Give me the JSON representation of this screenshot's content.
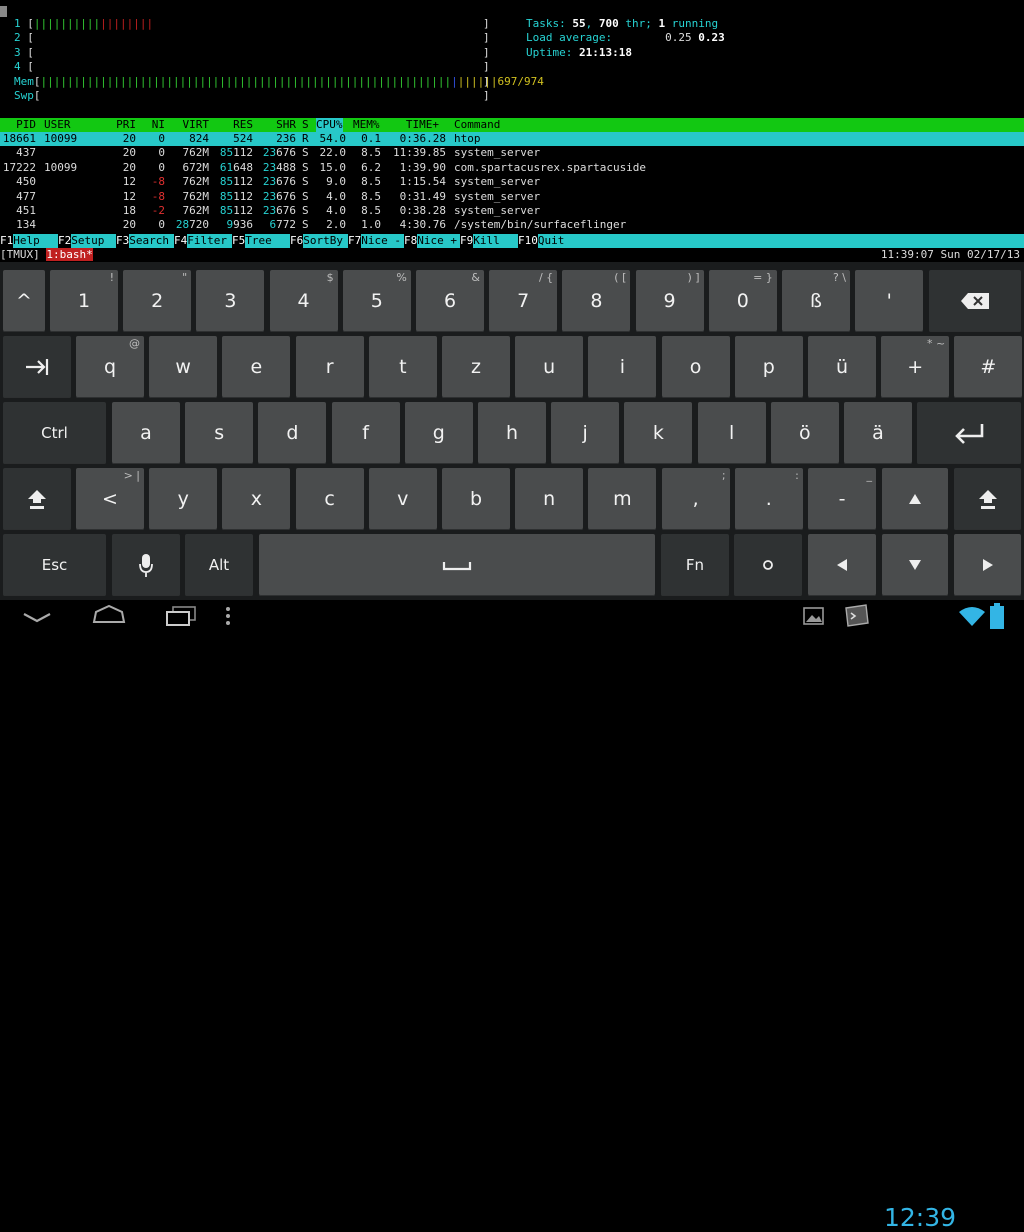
{
  "meters": {
    "cpu": [
      {
        "label": "1",
        "green": "||||||||||",
        "red": "||||||||"
      },
      {
        "label": "2",
        "green": "",
        "red": ""
      },
      {
        "label": "3",
        "green": "",
        "red": ""
      },
      {
        "label": "4",
        "green": "",
        "red": ""
      }
    ],
    "mem": {
      "label": "Mem",
      "bar": "||||||||||||||||||||||||||||||||||||||||||||||||||||||||||||||",
      "tail": "||||||",
      "value": "697/974"
    },
    "swp": {
      "label": "Swp"
    }
  },
  "stats": {
    "tasks_label": "Tasks: ",
    "tasks": "55",
    "thr_sep": ", ",
    "thr": "700",
    "thr_label": " thr; ",
    "running": "1",
    "running_label": " running",
    "load_label": "Load average:",
    "load1": "0.25",
    "load5": "0.23",
    "uptime_label": "Uptime: ",
    "uptime": "21:13:18"
  },
  "columns": [
    "PID",
    "USER",
    "PRI",
    "NI",
    "VIRT",
    "RES",
    "SHR",
    "S",
    "CPU%",
    "MEM%",
    "TIME+",
    "Command"
  ],
  "processes": [
    {
      "pid": "18661",
      "user": "10099",
      "pri": "20",
      "ni": "0",
      "virt": "824",
      "res": "524",
      "shr": "236",
      "s": "R",
      "cpu": "54.0",
      "mem": "0.1",
      "time": "0:36.28",
      "cmd": "htop"
    },
    {
      "pid": "437",
      "user": "",
      "pri": "20",
      "ni": "0",
      "virt": "762M",
      "res": "85112",
      "shr": "23676",
      "s": "S",
      "cpu": "22.0",
      "mem": "8.5",
      "time": "11:39.85",
      "cmd": "system_server"
    },
    {
      "pid": "17222",
      "user": "10099",
      "pri": "20",
      "ni": "0",
      "virt": "672M",
      "res": "61648",
      "shr": "23488",
      "s": "S",
      "cpu": "15.0",
      "mem": "6.2",
      "time": "1:39.90",
      "cmd": "com.spartacusrex.spartacuside"
    },
    {
      "pid": "450",
      "user": "",
      "pri": "12",
      "ni": "-8",
      "virt": "762M",
      "res": "85112",
      "shr": "23676",
      "s": "S",
      "cpu": "9.0",
      "mem": "8.5",
      "time": "1:15.54",
      "cmd": "system_server"
    },
    {
      "pid": "477",
      "user": "",
      "pri": "12",
      "ni": "-8",
      "virt": "762M",
      "res": "85112",
      "shr": "23676",
      "s": "S",
      "cpu": "4.0",
      "mem": "8.5",
      "time": "0:31.49",
      "cmd": "system_server"
    },
    {
      "pid": "451",
      "user": "",
      "pri": "18",
      "ni": "-2",
      "virt": "762M",
      "res": "85112",
      "shr": "23676",
      "s": "S",
      "cpu": "4.0",
      "mem": "8.5",
      "time": "0:38.28",
      "cmd": "system_server"
    },
    {
      "pid": "134",
      "user": "",
      "pri": "20",
      "ni": "0",
      "virt": "28720",
      "res": "9936",
      "shr": "6772",
      "s": "S",
      "cpu": "2.0",
      "mem": "1.0",
      "time": "4:30.76",
      "cmd": "/system/bin/surfaceflinger"
    }
  ],
  "fkeys": [
    {
      "n": "F1",
      "l": "Help"
    },
    {
      "n": "F2",
      "l": "Setup"
    },
    {
      "n": "F3",
      "l": "Search"
    },
    {
      "n": "F4",
      "l": "Filter"
    },
    {
      "n": "F5",
      "l": "Tree"
    },
    {
      "n": "F6",
      "l": "SortBy"
    },
    {
      "n": "F7",
      "l": "Nice -"
    },
    {
      "n": "F8",
      "l": "Nice +"
    },
    {
      "n": "F9",
      "l": "Kill"
    },
    {
      "n": "F10",
      "l": "Quit"
    }
  ],
  "tmux": {
    "session": "[TMUX]",
    "window": "1:bash*",
    "clock": "11:39:07 Sun 02/17/13"
  },
  "keyboard": {
    "row1": [
      {
        "k": "^",
        "s": ""
      },
      {
        "k": "1",
        "s": "!"
      },
      {
        "k": "2",
        "s": "\""
      },
      {
        "k": "3",
        "s": ""
      },
      {
        "k": "4",
        "s": "$"
      },
      {
        "k": "5",
        "s": "%"
      },
      {
        "k": "6",
        "s": "&"
      },
      {
        "k": "7",
        "s": "/ {"
      },
      {
        "k": "8",
        "s": "( ["
      },
      {
        "k": "9",
        "s": ") ]"
      },
      {
        "k": "0",
        "s": "= }"
      },
      {
        "k": "ß",
        "s": "? \\"
      },
      {
        "k": "'",
        "s": ""
      }
    ],
    "row2": [
      {
        "k": "q",
        "s": "@"
      },
      {
        "k": "w",
        "s": ""
      },
      {
        "k": "e",
        "s": ""
      },
      {
        "k": "r",
        "s": ""
      },
      {
        "k": "t",
        "s": ""
      },
      {
        "k": "z",
        "s": ""
      },
      {
        "k": "u",
        "s": ""
      },
      {
        "k": "i",
        "s": ""
      },
      {
        "k": "o",
        "s": ""
      },
      {
        "k": "p",
        "s": ""
      },
      {
        "k": "ü",
        "s": ""
      },
      {
        "k": "+",
        "s": "* ~"
      },
      {
        "k": "#",
        "s": ""
      }
    ],
    "ctrl": "Ctrl",
    "row3": [
      {
        "k": "a"
      },
      {
        "k": "s"
      },
      {
        "k": "d"
      },
      {
        "k": "f"
      },
      {
        "k": "g"
      },
      {
        "k": "h"
      },
      {
        "k": "j"
      },
      {
        "k": "k"
      },
      {
        "k": "l"
      },
      {
        "k": "ö"
      },
      {
        "k": "ä"
      }
    ],
    "row4": [
      {
        "k": "<",
        "s": "> |"
      },
      {
        "k": "y",
        "s": ""
      },
      {
        "k": "x",
        "s": ""
      },
      {
        "k": "c",
        "s": ""
      },
      {
        "k": "v",
        "s": ""
      },
      {
        "k": "b",
        "s": ""
      },
      {
        "k": "n",
        "s": ""
      },
      {
        "k": "m",
        "s": ""
      },
      {
        "k": ",",
        "s": ";"
      },
      {
        "k": ".",
        "s": ":"
      },
      {
        "k": "-",
        "s": "_"
      }
    ],
    "esc": "Esc",
    "alt": "Alt",
    "fn": "Fn"
  },
  "status": {
    "time": "12:39"
  },
  "colors": {
    "accent": "#33b5e5",
    "term_cyan": "#27c8c8",
    "term_green": "#12c812"
  }
}
